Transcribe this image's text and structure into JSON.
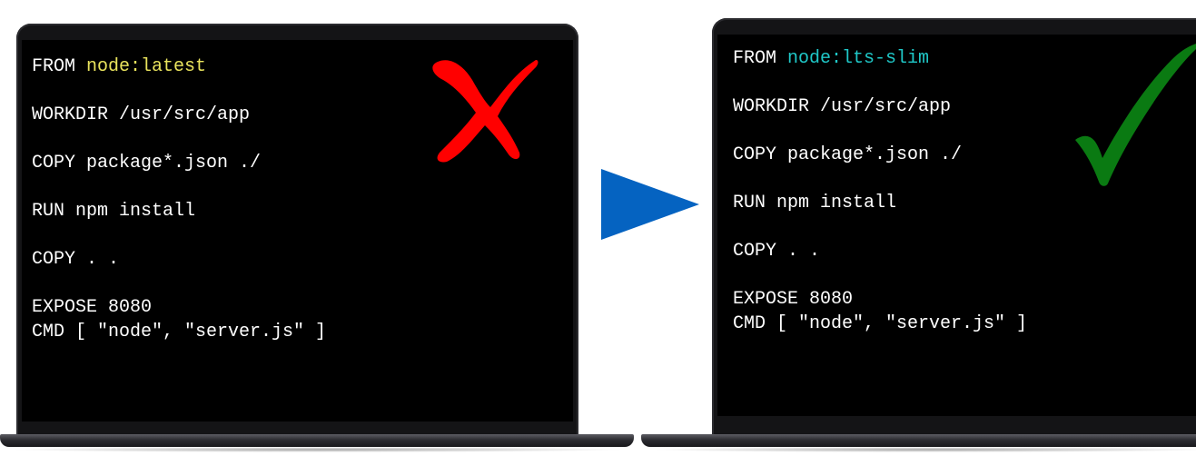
{
  "left_laptop": {
    "lines": [
      {
        "prefix": "FROM ",
        "highlight": "node:latest"
      },
      {
        "text": ""
      },
      {
        "text": "WORKDIR /usr/src/app"
      },
      {
        "text": ""
      },
      {
        "text": "COPY package*.json ./"
      },
      {
        "text": ""
      },
      {
        "text": "RUN npm install"
      },
      {
        "text": ""
      },
      {
        "text": "COPY . ."
      },
      {
        "text": ""
      },
      {
        "text": "EXPOSE 8080"
      },
      {
        "text": "CMD [ \"node\", \"server.js\" ]"
      }
    ],
    "highlight_color": "#e9e35d",
    "status_icon": "cross-mark-icon",
    "status_color": "#ff0000"
  },
  "right_laptop": {
    "lines": [
      {
        "prefix": "FROM ",
        "highlight": "node:lts-slim"
      },
      {
        "text": ""
      },
      {
        "text": "WORKDIR /usr/src/app"
      },
      {
        "text": ""
      },
      {
        "text": "COPY package*.json ./"
      },
      {
        "text": ""
      },
      {
        "text": "RUN npm install"
      },
      {
        "text": ""
      },
      {
        "text": "COPY . ."
      },
      {
        "text": ""
      },
      {
        "text": "EXPOSE 8080"
      },
      {
        "text": "CMD [ \"node\", \"server.js\" ]"
      }
    ],
    "highlight_color": "#1fc8c8",
    "status_icon": "check-mark-icon",
    "status_color": "#0a7a12"
  },
  "transition_icon": "play-arrow-icon",
  "transition_color": "#0563c1"
}
